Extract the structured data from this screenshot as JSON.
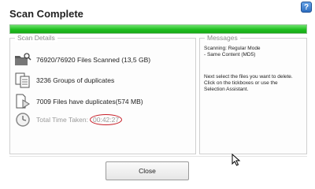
{
  "window": {
    "title": "Scan Complete",
    "help_label": "?"
  },
  "progress": {
    "fraction": 1.0
  },
  "details": {
    "legend": "Scan Details",
    "files_scanned": "76920/76920 Files Scanned (13,5 GB)",
    "groups": "3236 Groups of duplicates",
    "duplicates": "7009 Files have duplicates(574 MB)",
    "time_label": "Total Time Taken:",
    "time_value": "00:42:27"
  },
  "messages": {
    "legend": "Messages",
    "scan_mode": "Scanning: Regular Mode\n- Same Content (MD5)",
    "instructions": "Next select the files you want to delete.\nClick on the tickboxes or use the\nSelection Assistant."
  },
  "buttons": {
    "close_label": "Close"
  },
  "icons": {
    "help": "help-icon",
    "folder_search": "folder-search-icon",
    "documents": "documents-icon",
    "duplicate_file": "duplicate-file-icon",
    "clock": "clock-icon"
  },
  "colors": {
    "progress": "#1fbf1f",
    "help": "#2f6fc0",
    "time_highlight": "#c8202a"
  }
}
